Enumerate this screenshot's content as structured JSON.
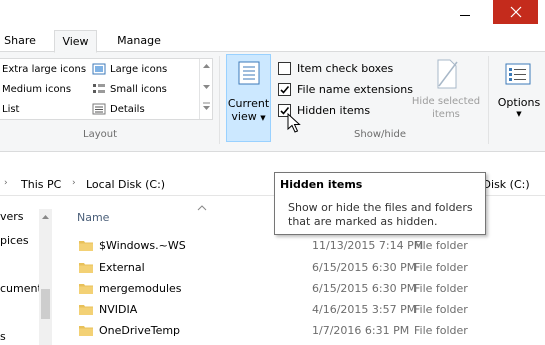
{
  "window": {
    "min_icon": "minimize-icon",
    "close_icon": "close-icon",
    "close_color": "#c42b1c"
  },
  "tabs": [
    {
      "label": "Share",
      "active": false
    },
    {
      "label": "View",
      "active": true
    },
    {
      "label": "Manage",
      "active": false
    }
  ],
  "layout_group": {
    "label": "Layout",
    "items": [
      {
        "label": "Extra large icons",
        "icon": "extra-large-icons-icon"
      },
      {
        "label": "Large icons",
        "icon": "large-icons-icon"
      },
      {
        "label": "Medium icons",
        "icon": "medium-icons-icon"
      },
      {
        "label": "Small icons",
        "icon": "small-icons-icon"
      },
      {
        "label": "List",
        "icon": "list-icon"
      },
      {
        "label": "Details",
        "icon": "details-icon"
      }
    ]
  },
  "current_view": {
    "line1": "Current",
    "line2": "view"
  },
  "show_hide": {
    "label": "Show/hide",
    "item_check_boxes": {
      "label": "Item check boxes",
      "checked": false
    },
    "file_name_extensions": {
      "label": "File name extensions",
      "checked": true
    },
    "hidden_items": {
      "label": "Hidden items",
      "checked": true
    },
    "hide_selected": {
      "line1": "Hide selected",
      "line2": "items"
    }
  },
  "options": {
    "label": "Options"
  },
  "address": {
    "segments": [
      "This PC",
      "Local Disk (C:)"
    ],
    "behind_tooltip": "l Disk (C:)"
  },
  "nav_pane": {
    "items": [
      "vers",
      "pices",
      "",
      "cument",
      "s"
    ]
  },
  "columns": {
    "name": "Name"
  },
  "files": [
    {
      "name": "$Windows.~WS",
      "date": "11/13/2015 7:14 PM",
      "type": "File folder"
    },
    {
      "name": "External",
      "date": "6/15/2015 6:30 PM",
      "type": "File folder"
    },
    {
      "name": "mergemodules",
      "date": "6/15/2015 6:30 PM",
      "type": "File folder"
    },
    {
      "name": "NVIDIA",
      "date": "4/16/2015 3:57 PM",
      "type": "File folder"
    },
    {
      "name": "OneDriveTemp",
      "date": "1/7/2016 6:31 PM",
      "type": "File folder"
    }
  ],
  "tooltip": {
    "title": "Hidden items",
    "line1": "Show or hide the files and folders",
    "line2": "that are marked as hidden."
  },
  "colors": {
    "folder": "#e8c15a",
    "ribbon_bg": "#f5f6f7",
    "hover": "#cce8ff"
  }
}
